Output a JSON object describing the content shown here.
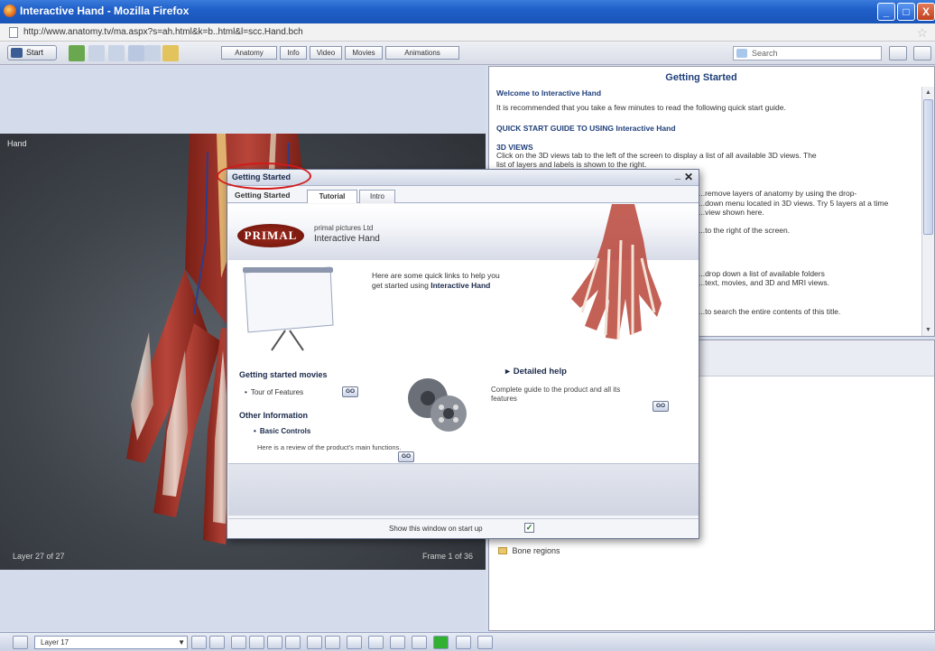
{
  "window": {
    "title": "Interactive Hand - Mozilla Firefox",
    "controls": [
      "_",
      "□",
      "X"
    ]
  },
  "address": {
    "url": "http://www.anatomy.tv/ma.aspx?s=ah.html&k=b..html&l=scc.Hand.bch"
  },
  "toolbar": {
    "start_label": "Start",
    "tabs": [
      "Anatomy",
      "Info",
      "Video",
      "Movies",
      "Animations"
    ],
    "search_placeholder": "Search"
  },
  "viewer": {
    "label": "Hand",
    "layer_readout": "Layer 27 of 27",
    "frame_readout": "Frame 1 of 36"
  },
  "help": {
    "title": "Getting Started",
    "lines": [
      "Welcome to Interactive Hand",
      "It is recommended that you take a few minutes to read the following quick start guide.",
      "QUICK START GUIDE TO USING Interactive Hand",
      "3D VIEWS",
      "Click on the 3D views tab to the left of the screen to display a list of all available 3D views. The",
      "list of layers and labels is shown to the right.",
      "...remove layers of anatomy by using the drop-",
      "...down menu located in 3D views. Try 5 layers at a time",
      "...view shown here.",
      "...to the right of the screen.",
      "...drop down a list of available folders",
      "...text, movies, and 3D and MRI views.",
      "...to search the entire contents of this title."
    ]
  },
  "layers": {
    "tree_item": "Bone regions"
  },
  "bottombar": {
    "layer_select": "Layer 17"
  },
  "dialog": {
    "title": "Getting Started",
    "heading": "Getting Started",
    "tabs": [
      "Tutorial",
      "Intro"
    ],
    "brand_line1": "primal pictures Ltd",
    "brand_line2": "Interactive Hand",
    "logo": "PRIMAL",
    "intro_line1": "Here are some quick links to help you",
    "intro_line2_prefix": "get started using ",
    "intro_line2_bold": "Interactive Hand",
    "movies_heading": "Getting started movies",
    "tour": "Tour of Features",
    "other_heading": "Other Information",
    "basic": "Basic Controls",
    "basic_desc": "Here is a review of the product's main functions.",
    "detailed": "Detailed help",
    "detailed_desc": "Complete guide to the product and all its features",
    "go_label": "GO",
    "show_label": "Show this window on start up",
    "checkbox": "✓"
  },
  "colors": {
    "title_bar": "#2b6ad6",
    "viewer_bg": "#4a4f57",
    "annotation_circle": "#d11a1a"
  }
}
